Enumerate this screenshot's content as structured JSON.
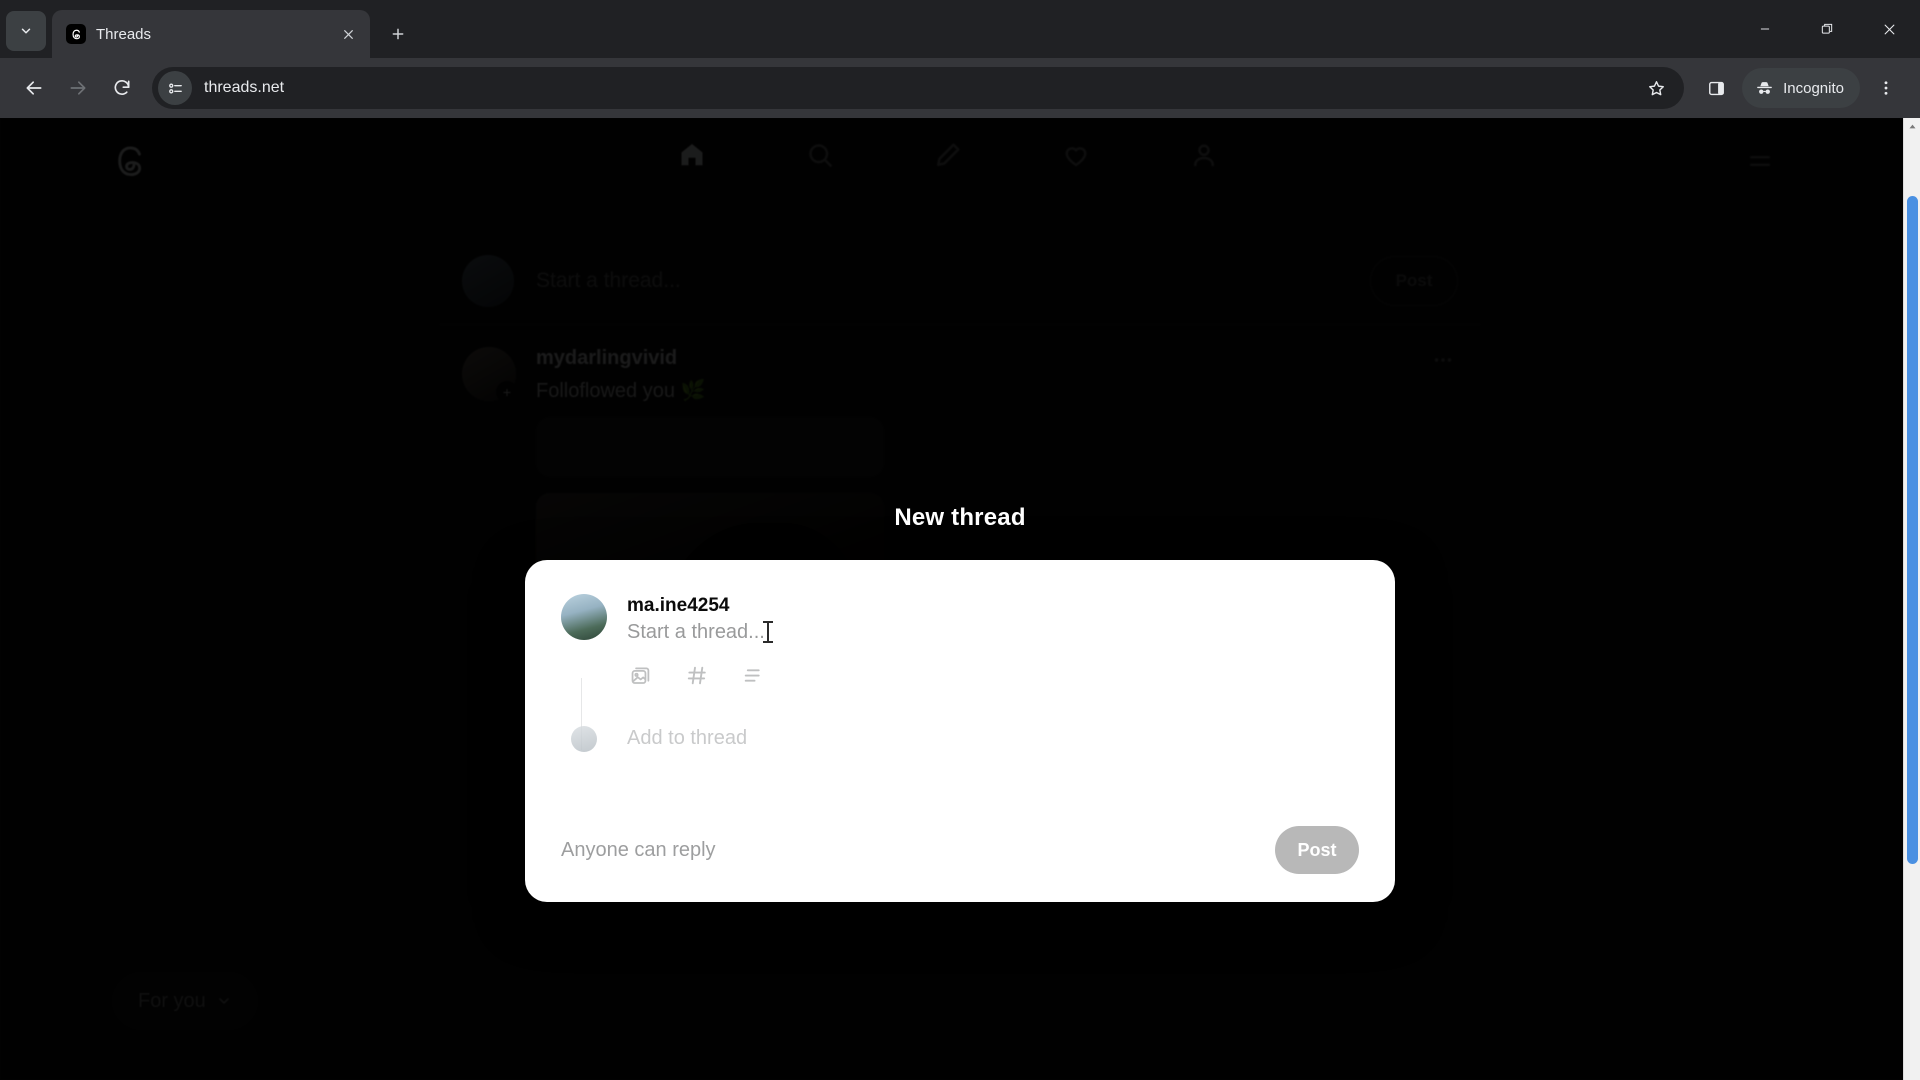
{
  "browser": {
    "tab": {
      "title": "Threads",
      "favicon_icon": "threads-logo-icon",
      "close_icon": "close-icon"
    },
    "tab_search_icon": "chevron-down-icon",
    "new_tab_icon": "plus-icon",
    "window_controls": {
      "minimize_icon": "minimize-icon",
      "maximize_icon": "restore-icon",
      "close_icon": "close-icon"
    },
    "nav": {
      "back_icon": "back-arrow-icon",
      "forward_icon": "forward-arrow-icon",
      "reload_icon": "reload-icon"
    },
    "omnibox": {
      "site_settings_icon": "site-settings-sliders-icon",
      "url": "threads.net",
      "bookmark_icon": "star-icon"
    },
    "side_panel_icon": "side-panel-icon",
    "incognito": {
      "label": "Incognito",
      "icon": "incognito-hat-icon"
    },
    "more_menu_icon": "three-dot-menu-icon",
    "scrollbar": {
      "up_arrow_icon": "scroll-up-icon",
      "down_arrow_icon": "scroll-down-icon"
    }
  },
  "app": {
    "logo_icon": "threads-logo-icon",
    "nav_items": [
      {
        "name": "home",
        "icon": "home-icon",
        "active": true
      },
      {
        "name": "search",
        "icon": "search-icon",
        "active": false
      },
      {
        "name": "compose",
        "icon": "compose-icon",
        "active": false
      },
      {
        "name": "activity",
        "icon": "heart-icon",
        "active": false
      },
      {
        "name": "profile",
        "icon": "profile-icon",
        "active": false
      }
    ],
    "menu_icon": "hamburger-menu-icon",
    "composer": {
      "placeholder": "Start a thread...",
      "post_label": "Post"
    },
    "post": {
      "username": "mydarlingvivid",
      "text": "Folloflowed you 🌿",
      "timestamp": "",
      "more_icon": "three-dot-menu-icon",
      "media_mute_icon": "mute-icon",
      "actions": [
        {
          "name": "like",
          "icon": "heart-icon"
        },
        {
          "name": "reply",
          "icon": "comment-icon"
        },
        {
          "name": "repost",
          "icon": "repost-icon"
        },
        {
          "name": "share",
          "icon": "share-icon"
        }
      ]
    },
    "feed_filter": {
      "label": "For you",
      "icon": "feed-chevron-icon"
    }
  },
  "modal": {
    "title": "New thread",
    "username": "ma.ine4254",
    "placeholder": "Start a thread...",
    "tool_icons": [
      {
        "name": "attach-media",
        "icon": "image-stack-icon"
      },
      {
        "name": "add-tag",
        "icon": "hashtag-icon"
      },
      {
        "name": "add-poll",
        "icon": "poll-icon"
      }
    ],
    "add_to_thread_label": "Add to thread",
    "reply_setting": "Anyone can reply",
    "post_label": "Post"
  },
  "colors": {
    "accent_scrollbar": "#4a90e2",
    "modal_background": "#ffffff",
    "post_button": "#b8b8b8",
    "chrome_dark": "#202124",
    "toolbar": "#35363a"
  }
}
